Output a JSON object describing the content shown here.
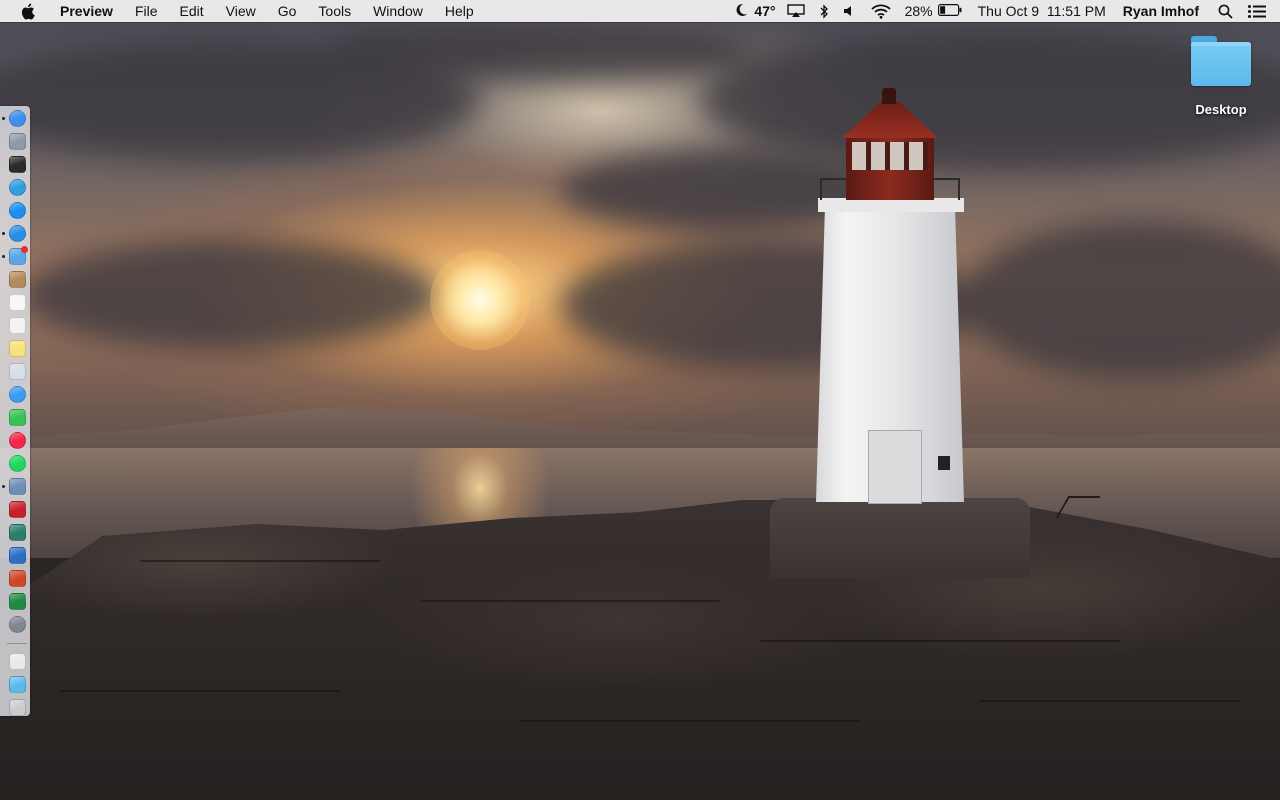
{
  "menubar": {
    "apple_icon": "apple-logo-icon",
    "app_name": "Preview",
    "menus": [
      "File",
      "Edit",
      "View",
      "Go",
      "Tools",
      "Window",
      "Help"
    ],
    "status": {
      "weather_icon": "moon-icon",
      "temperature": "47°",
      "airplay_icon": "airplay-icon",
      "bluetooth_icon": "bluetooth-icon",
      "volume_icon": "volume-icon",
      "wifi_icon": "wifi-icon",
      "battery_percent": "28%",
      "battery_level": 0.28,
      "battery_icon": "battery-icon",
      "datetime": "Thu Oct 9  11:51 PM",
      "user_name": "Ryan Imhof",
      "spotlight_icon": "spotlight-search-icon",
      "notification_icon": "notification-center-icon"
    }
  },
  "dock": {
    "apps": [
      {
        "name": "finder",
        "running": true,
        "color": "#3d8ef0"
      },
      {
        "name": "launchpad",
        "running": false,
        "color": "#8e9aa8"
      },
      {
        "name": "mission-control",
        "running": false,
        "color": "#2b2b2b"
      },
      {
        "name": "safari-compass",
        "running": false,
        "color": "#2f9fe0"
      },
      {
        "name": "app-store",
        "running": false,
        "color": "#1f8ef1"
      },
      {
        "name": "safari",
        "running": true,
        "color": "#2a8ee6"
      },
      {
        "name": "mail",
        "running": true,
        "color": "#5aa7e8",
        "badge": true
      },
      {
        "name": "contacts",
        "running": false,
        "color": "#b38b5b"
      },
      {
        "name": "calendar",
        "running": false,
        "color": "#f7f7f7"
      },
      {
        "name": "reminders",
        "running": false,
        "color": "#f2f2f2"
      },
      {
        "name": "notes",
        "running": false,
        "color": "#f8e27a"
      },
      {
        "name": "preview",
        "running": false,
        "color": "#d5dde6"
      },
      {
        "name": "messages",
        "running": false,
        "color": "#3c9bf5"
      },
      {
        "name": "facetime",
        "running": false,
        "color": "#37c253"
      },
      {
        "name": "itunes",
        "running": false,
        "color": "#f2274a"
      },
      {
        "name": "spotify",
        "running": false,
        "color": "#1ed760"
      },
      {
        "name": "photos",
        "running": true,
        "color": "#6f8fb8"
      },
      {
        "name": "photo-booth",
        "running": false,
        "color": "#c8202a"
      },
      {
        "name": "iphoto",
        "running": false,
        "color": "#2c7d6a"
      },
      {
        "name": "word",
        "running": false,
        "color": "#2b6fc4"
      },
      {
        "name": "powerpoint",
        "running": false,
        "color": "#d24726"
      },
      {
        "name": "excel",
        "running": false,
        "color": "#1e8a45"
      },
      {
        "name": "system-preferences",
        "running": false,
        "color": "#808890"
      }
    ],
    "stack_items": [
      {
        "name": "documents-stack",
        "color": "#e9e9ea"
      },
      {
        "name": "downloads-folder",
        "color": "#5bb9ec"
      },
      {
        "name": "trash",
        "color": "#c9cbce"
      }
    ]
  },
  "desktop": {
    "folder_label": "Desktop",
    "folder_icon": "folder-icon",
    "folder_color": "#5bb9ec",
    "wallpaper": "lighthouse-sunset"
  }
}
